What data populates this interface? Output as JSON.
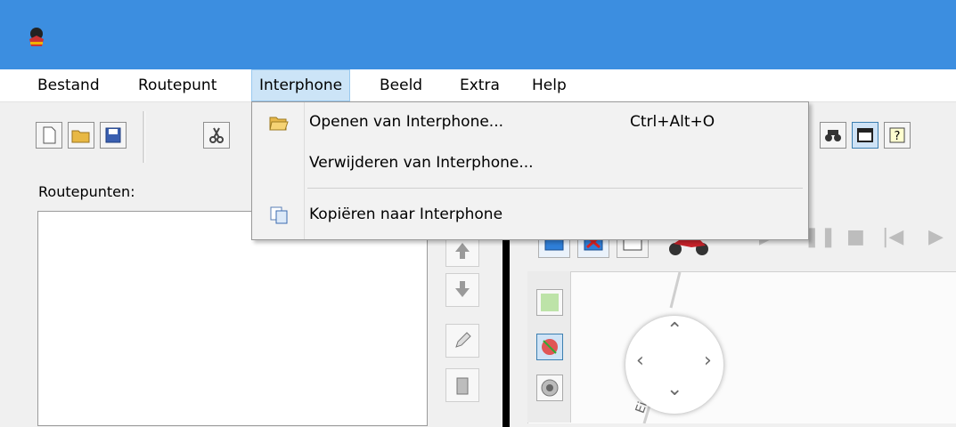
{
  "menubar": {
    "items": [
      {
        "label": "Bestand"
      },
      {
        "label": "Routepunt"
      },
      {
        "label": "Interphone",
        "active": true
      },
      {
        "label": "Beeld"
      },
      {
        "label": "Extra"
      },
      {
        "label": "Help"
      }
    ]
  },
  "dropdown": {
    "items": [
      {
        "label": "Openen van Interphone...",
        "shortcut": "Ctrl+Alt+O",
        "icon": "folder-open-icon"
      },
      {
        "label": "Verwijderen van Interphone...",
        "shortcut": "",
        "icon": ""
      },
      {
        "label": "Kopiëren naar Interphone",
        "shortcut": "",
        "icon": "copy-icon"
      }
    ]
  },
  "left_panel": {
    "label": "Routepunten:"
  },
  "map": {
    "road_label": "Ein"
  },
  "colors": {
    "titlebar": "#3c8ee0",
    "menu_active": "#cce4f7",
    "dropdown_bg": "#f2f2f2"
  }
}
